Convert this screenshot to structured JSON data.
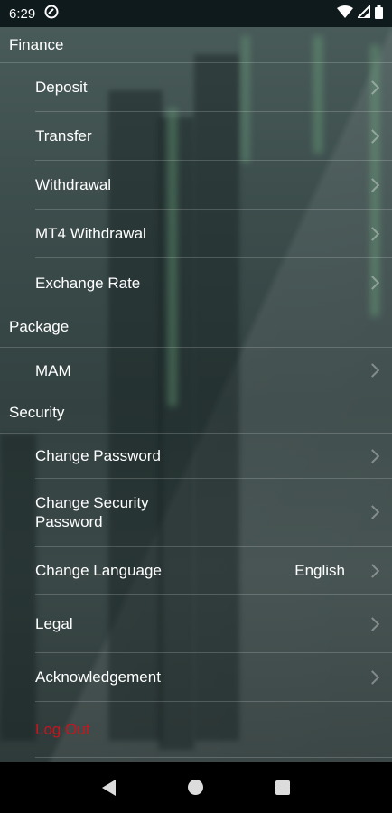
{
  "status_bar": {
    "time": "6:29"
  },
  "menu": {
    "finance": {
      "title": "Finance",
      "items": [
        {
          "label": "Deposit"
        },
        {
          "label": "Transfer"
        },
        {
          "label": "Withdrawal"
        },
        {
          "label": "MT4 Withdrawal"
        },
        {
          "label": "Exchange Rate"
        }
      ]
    },
    "package": {
      "title": "Package",
      "items": [
        {
          "label": "MAM"
        }
      ]
    },
    "security": {
      "title": "Security",
      "items": [
        {
          "label": "Change Password"
        },
        {
          "label": "Change Security\nPassword"
        },
        {
          "label": "Change Language",
          "value": "English"
        },
        {
          "label": "Legal"
        },
        {
          "label": "Acknowledgement"
        }
      ]
    },
    "logout_label": "Log Out"
  },
  "colors": {
    "logout": "#c8151d",
    "status_bar_bg": "#0f1a1c"
  }
}
